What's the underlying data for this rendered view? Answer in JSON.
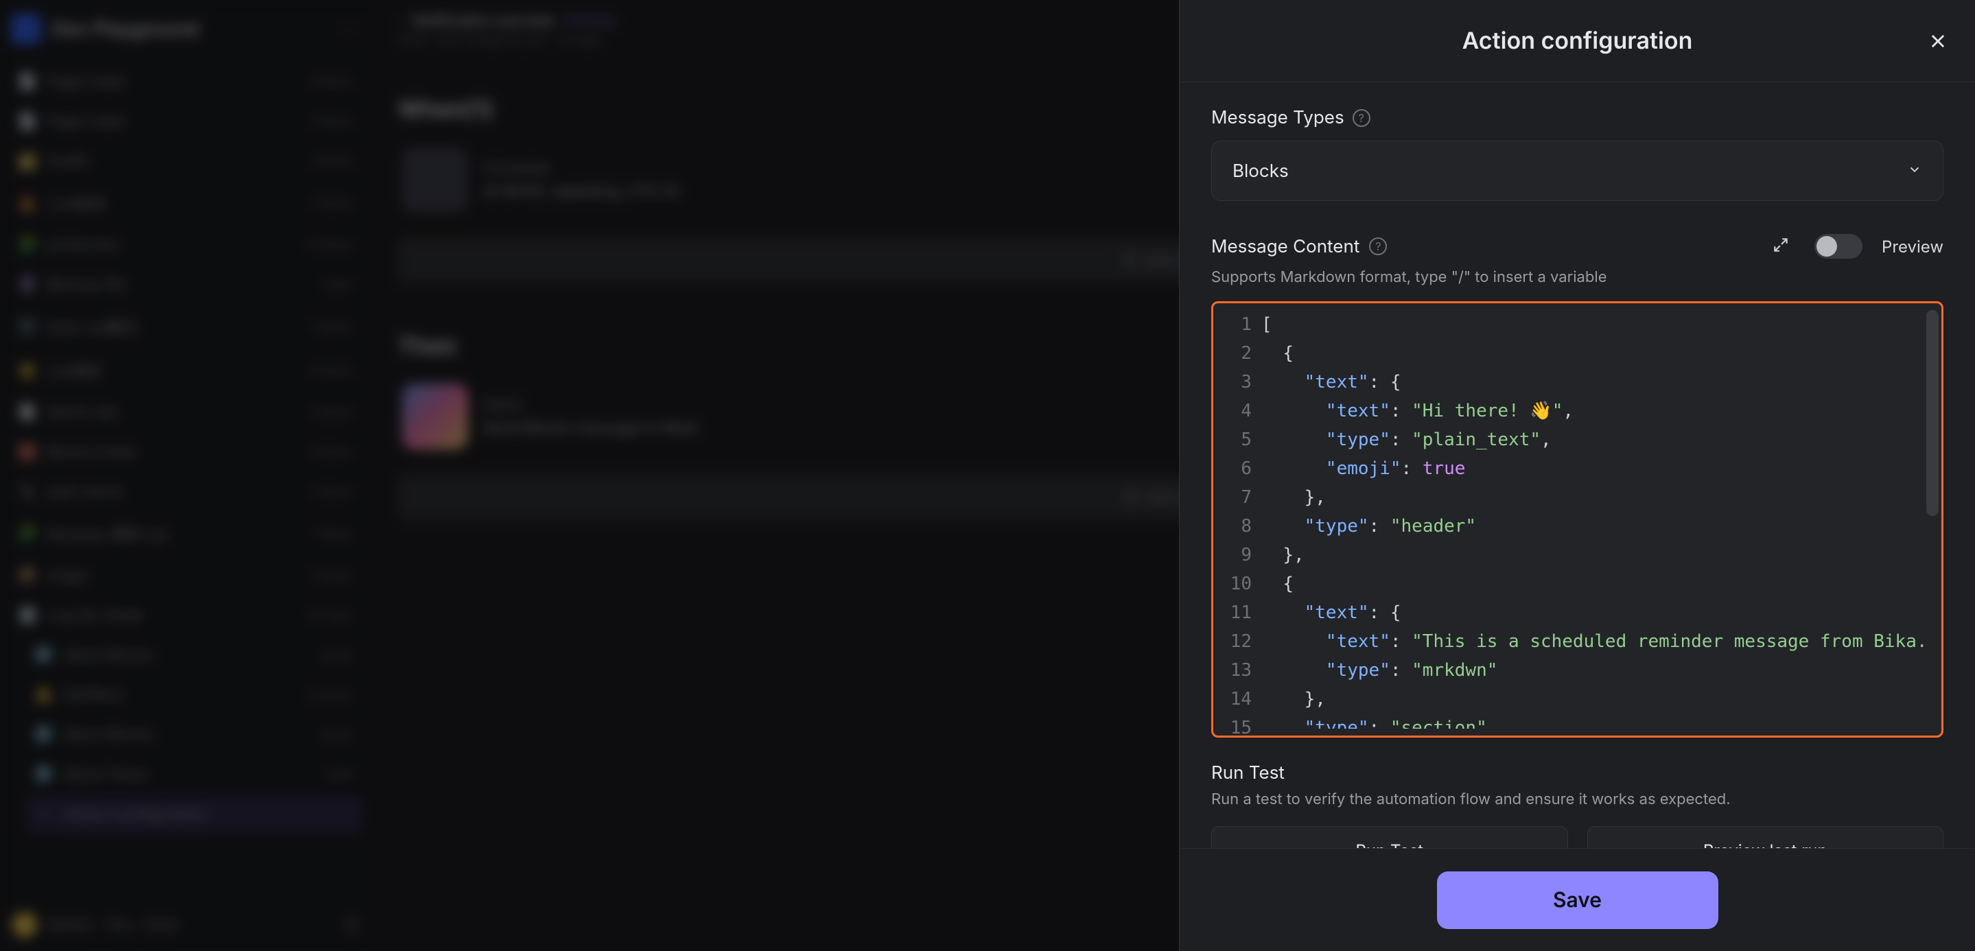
{
  "sidebar": {
    "workspace": "Dev Playground",
    "items": [
      {
        "icon": "📄",
        "label": "Page Index",
        "badge": "8 items"
      },
      {
        "icon": "📄",
        "label": "Page Index",
        "badge": "5 items"
      },
      {
        "icon": "🗂️",
        "label": "Drafts",
        "badge": "3 items"
      },
      {
        "icon": "🔥",
        "label": "Live板块",
        "badge": "2 items"
      },
      {
        "icon": "🧩",
        "label": "producers",
        "badge": "12 items"
      },
      {
        "icon": "🔮",
        "label": "Backup file",
        "badge": "1 item"
      },
      {
        "icon": "🗄️",
        "label": "Data-set集合",
        "badge": "4 items"
      },
      {
        "icon": "🌟",
        "label": "List事务",
        "badge": "6 items"
      },
      {
        "icon": "📑",
        "label": "Alerts-tab",
        "badge": "3 items"
      },
      {
        "icon": "🧱",
        "label": "Blocks Index",
        "badge": "9 items"
      },
      {
        "icon": "🔌",
        "label": "auth-block",
        "badge": "2 items"
      },
      {
        "icon": "🧩",
        "label": "Modules 模块 set",
        "badge": "7 items"
      },
      {
        "icon": "📦",
        "label": "snaps",
        "badge": "5 items"
      },
      {
        "icon": "🧾",
        "label": "Log db-sheet",
        "badge": "10 rows"
      }
    ],
    "sub_items": [
      {
        "icon": "🧊",
        "label": "Slack Blocks",
        "badge": "alpha"
      },
      {
        "icon": "🔔",
        "label": "Notifiers",
        "badge": "2 active"
      },
      {
        "icon": "🧊",
        "label": "Slack Blocks",
        "badge": "alpha"
      },
      {
        "icon": "🧊",
        "label": "Slack Flows",
        "badge": "draft"
      }
    ],
    "highlight": "Action configuration",
    "highlight_icon": "⚡",
    "user": "Admin · You · Host",
    "settings_icon": "gear-icon"
  },
  "main": {
    "crumb_prefix": "›",
    "crumb_strong": "Notification overview",
    "crumb_link": "Preview",
    "subline": "Draft · last change by you · 2m ago",
    "section1": {
      "title": "When(1)",
      "add": "➕ Add",
      "card_line1": "Schedule",
      "card_line2": "at 09:00, repeating, UTC+8",
      "button": "➕ Add trigger"
    },
    "section2": {
      "title": "Then",
      "add": "➕ Add",
      "card_line1": "Slack",
      "card_line2": "Send Blocks message to #test",
      "button": "➕ Add action"
    }
  },
  "panel": {
    "title": "Action configuration",
    "close_icon": "close-icon",
    "message_types_label": "Message Types",
    "message_types_help": "help-icon",
    "message_types_value": "Blocks",
    "message_content_label": "Message Content",
    "message_content_help": "help-icon",
    "expand_icon": "expand-icon",
    "preview_label": "Preview",
    "preview_on": false,
    "hint": "Supports Markdown format, type \"/\" to insert a variable",
    "code_lines": [
      "[",
      "  {",
      "    \"text\": {",
      "      \"text\": \"Hi there! 👋\",",
      "      \"type\": \"plain_text\",",
      "      \"emoji\": true",
      "    },",
      "    \"type\": \"header\"",
      "  },",
      "  {",
      "    \"text\": {",
      "      \"text\": \"This is a scheduled reminder message from Bika.",
      "      \"type\": \"mrkdwn\"",
      "    },",
      "    \"type\": \"section\","
    ],
    "line_numbers": [
      "1",
      "2",
      "3",
      "4",
      "5",
      "6",
      "7",
      "8",
      "9",
      "10",
      "11",
      "12",
      "13",
      "14",
      "15"
    ],
    "run_test_label": "Run Test",
    "run_test_desc": "Run a test to verify the automation flow and ensure it works as expected.",
    "btn_run": "Run Test",
    "btn_preview": "Preview last run",
    "save": "Save"
  }
}
